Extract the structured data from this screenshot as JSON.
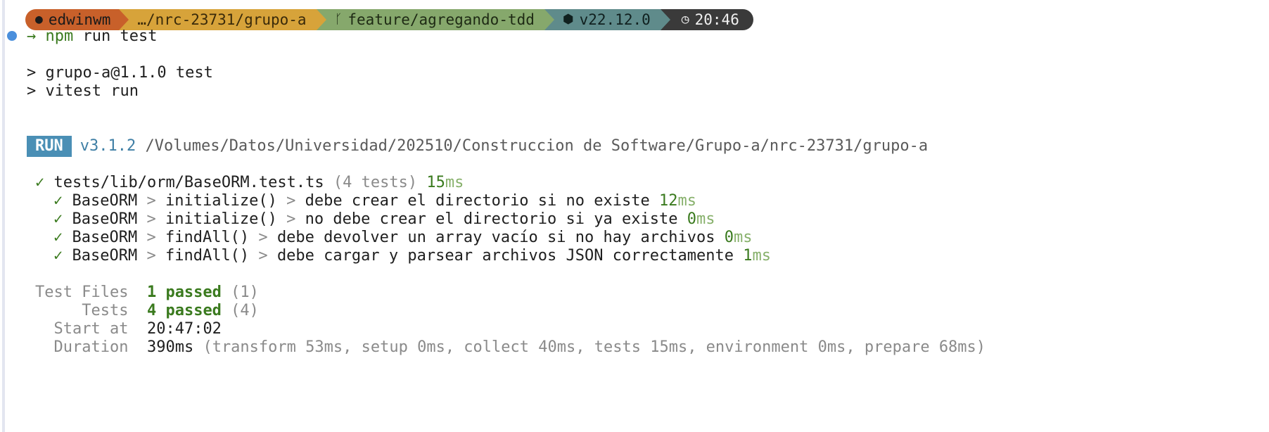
{
  "prompt": {
    "user": "edwinwm",
    "path": "…/nrc-23731/grupo-a",
    "branch": "feature/agregando-tdd",
    "node_version": "v22.12.0",
    "time": "20:46",
    "icons": {
      "user": "apple-icon",
      "branch": "git-branch-icon",
      "node": "hexagon-icon",
      "time": "clock-icon"
    },
    "colors": {
      "user": "#c8602a",
      "path": "#d7a33a",
      "git": "#86a86c",
      "node": "#5f8b8b",
      "time": "#3a3a3a"
    }
  },
  "command": {
    "arrow": "→",
    "program": "npm",
    "args": " run test"
  },
  "script_lines": [
    "> grupo-a@1.1.0 test",
    "> vitest run"
  ],
  "run": {
    "badge": "RUN",
    "version": "v3.1.2",
    "path": "/Volumes/Datos/Universidad/202510/Construccion de Software/Grupo-a/nrc-23731/grupo-a"
  },
  "file_result": {
    "check": "✓",
    "file": "tests/lib/orm/BaseORM.test.ts",
    "count": "(4 tests)",
    "time_num": "15",
    "time_unit": "ms"
  },
  "tests": [
    {
      "check": "✓",
      "suite": "BaseORM",
      "sep1": " > ",
      "method": "initialize()",
      "sep2": " > ",
      "name": "debe crear el directorio si no existe ",
      "time_num": "12",
      "time_unit": "ms"
    },
    {
      "check": "✓",
      "suite": "BaseORM",
      "sep1": " > ",
      "method": "initialize()",
      "sep2": " > ",
      "name": "no debe crear el directorio si ya existe ",
      "time_num": "0",
      "time_unit": "ms"
    },
    {
      "check": "✓",
      "suite": "BaseORM",
      "sep1": " > ",
      "method": "findAll()",
      "sep2": " > ",
      "name": "debe devolver un array vacío si no hay archivos ",
      "time_num": "0",
      "time_unit": "ms"
    },
    {
      "check": "✓",
      "suite": "BaseORM",
      "sep1": " > ",
      "method": "findAll()",
      "sep2": " > ",
      "name": "debe cargar y parsear archivos JSON correctamente ",
      "time_num": "1",
      "time_unit": "ms"
    }
  ],
  "summary": {
    "test_files_label": "Test Files",
    "test_files_passed": "1 passed",
    "test_files_total": " (1)",
    "tests_label": "Tests",
    "tests_passed": "4 passed",
    "tests_total": " (4)",
    "start_label": "Start at",
    "start_value": "20:47:02",
    "duration_label": "Duration",
    "duration_value": "390ms",
    "duration_detail": " (transform 53ms, setup 0ms, collect 40ms, tests 15ms, environment 0ms, prepare 68ms)"
  }
}
